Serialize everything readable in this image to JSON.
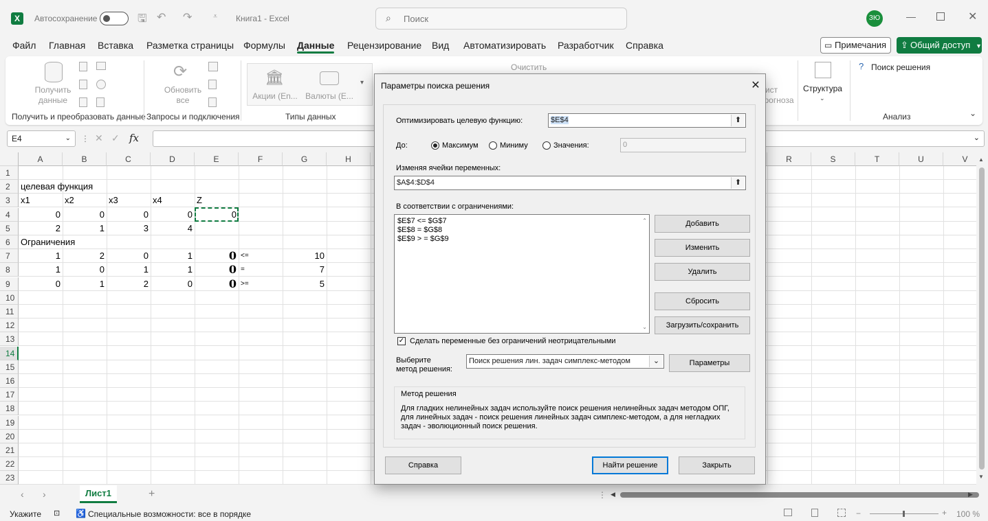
{
  "titlebar": {
    "autosave_label": "Автосохранение",
    "doc_title": "Книга1  -  Excel",
    "search_placeholder": "Поиск",
    "avatar_initials": "ЗЮ"
  },
  "menu": {
    "items": [
      "Файл",
      "Главная",
      "Вставка",
      "Разметка страницы",
      "Формулы",
      "Данные",
      "Рецензирование",
      "Вид",
      "Автоматизировать",
      "Разработчик",
      "Справка"
    ],
    "active": "Данные",
    "notes_label": "Примечания",
    "share_label": "Общий доступ"
  },
  "ribbon": {
    "get_data": "Получить\nданные",
    "group1": "Получить и преобразовать данные",
    "refresh_all": "Обновить\nвсе",
    "group2": "Запросы и подключения",
    "stocks": "Акции (En...",
    "currencies": "Валюты (E...",
    "group3": "Типы данных",
    "clear": "Очистить",
    "forecast_sheet": "Лист\nпрогноза",
    "outline": "Структура",
    "solver": "Поиск решения",
    "group_analysis": "Анализ"
  },
  "formula_bar": {
    "name_box": "E4",
    "fx": "fx"
  },
  "grid": {
    "columns_left": [
      "A",
      "B",
      "C",
      "D",
      "E",
      "F",
      "G",
      "H"
    ],
    "columns_right": [
      "R",
      "S",
      "T",
      "U",
      "V"
    ],
    "rows": [
      "1",
      "2",
      "3",
      "4",
      "5",
      "6",
      "7",
      "8",
      "9",
      "10",
      "11",
      "12",
      "13",
      "14",
      "15",
      "16",
      "17",
      "18",
      "19",
      "20",
      "21",
      "22",
      "23"
    ],
    "selected_row": "14",
    "cells": {
      "A2": "целевая  функция",
      "A3": "x1",
      "B3": "x2",
      "C3": "x3",
      "D3": "x4",
      "E3": "Z",
      "A4": "0",
      "B4": "0",
      "C4": "0",
      "D4": "0",
      "E4": "0",
      "A5": "2",
      "B5": "1",
      "C5": "3",
      "D5": "4",
      "A6": "Ограничения",
      "A7": "1",
      "B7": "2",
      "C7": "0",
      "D7": "1",
      "E7": "0",
      "F7": "<=",
      "G7": "10",
      "A8": "1",
      "B8": "0",
      "C8": "1",
      "D8": "1",
      "E8": "0",
      "F8": "=",
      "G8": "7",
      "A9": "0",
      "B9": "1",
      "C9": "2",
      "D9": "0",
      "E9": "0",
      "F9": ">=",
      "G9": "5"
    }
  },
  "sheets": {
    "active_tab": "Лист1"
  },
  "status": {
    "ready": "Укажите",
    "accessibility": "Специальные возможности: все в порядке",
    "zoom": "100 %"
  },
  "solver": {
    "title": "Параметры поиска решения",
    "objective_label": "Оптимизировать целевую функцию:",
    "objective_value": "$E$4",
    "to_label": "До:",
    "opt_max": "Максимум",
    "opt_min": "Миниму",
    "opt_value": "Значения:",
    "value_field": "0",
    "changing_label": "Изменяя ячейки переменных:",
    "changing_value": "$A$4:$D$4",
    "constraints_label": "В соответствии с ограничениями:",
    "constraints": [
      "$E$7 <= $G$7",
      "$E$8 = $G$8",
      "$E$9 > = $G$9"
    ],
    "btn_add": "Добавить",
    "btn_change": "Изменить",
    "btn_delete": "Удалить",
    "btn_reset": "Сбросить",
    "btn_load_save": "Загрузить/сохранить",
    "nonneg_label": "Сделать переменные без ограничений неотрицательными",
    "nonneg_checked": true,
    "method_label": "Выберите\nметод решения:",
    "method_value": "Поиск решения лин. задач симплекс-методом",
    "btn_options": "Параметры",
    "method_group_title": "Метод решения",
    "method_desc": "Для гладких нелинейных задач используйте поиск решения нелинейных задач методом ОПГ, для линейных задач - поиск решения линейных задач симплекс-методом, а для негладких задач - эволюционный поиск решения.",
    "btn_help": "Справка",
    "btn_solve": "Найти решение",
    "btn_close": "Закрыть"
  }
}
